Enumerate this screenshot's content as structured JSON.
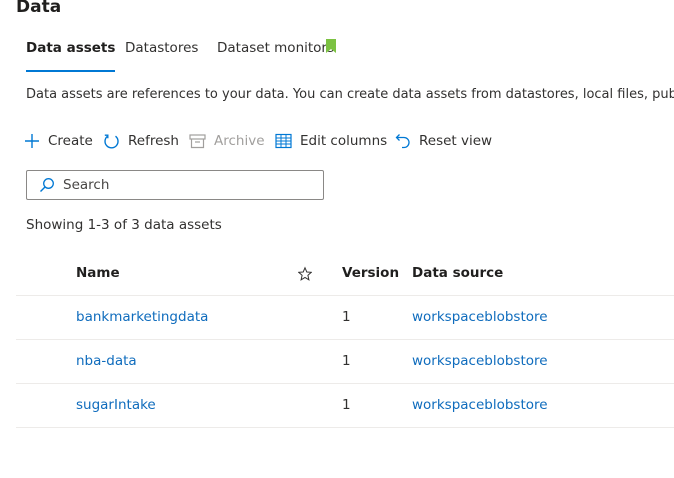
{
  "page": {
    "title": "Data"
  },
  "tabs": [
    {
      "label": "Data assets",
      "active": true
    },
    {
      "label": "Datastores",
      "active": false
    },
    {
      "label": "Dataset monitors",
      "active": false,
      "badge_icon": "bookmark-flag-icon",
      "badge_color": "#7cc242"
    }
  ],
  "description": "Data assets are references to your data. You can create data assets from datastores, local files, public URLs",
  "toolbar": {
    "create": {
      "label": "Create",
      "icon": "plus-icon"
    },
    "refresh": {
      "label": "Refresh",
      "icon": "refresh-icon"
    },
    "archive": {
      "label": "Archive",
      "icon": "archive-icon",
      "disabled": true
    },
    "edit_columns": {
      "label": "Edit columns",
      "icon": "columns-icon"
    },
    "reset_view": {
      "label": "Reset view",
      "icon": "undo-icon"
    }
  },
  "search": {
    "placeholder": "Search",
    "value": ""
  },
  "count_text": "Showing 1-3 of 3 data assets",
  "table": {
    "columns": {
      "name": "Name",
      "favorite_icon": "star-outline-icon",
      "version": "Version",
      "data_source": "Data source"
    },
    "rows": [
      {
        "name": "bankmarketingdata",
        "version": "1",
        "data_source": "workspaceblobstore"
      },
      {
        "name": "nba-data",
        "version": "1",
        "data_source": "workspaceblobstore"
      },
      {
        "name": "sugarIntake",
        "version": "1",
        "data_source": "workspaceblobstore"
      }
    ]
  },
  "colors": {
    "accent": "#0078d4",
    "link": "#0f6cbd",
    "text": "#323130",
    "disabled": "#a19f9d"
  }
}
